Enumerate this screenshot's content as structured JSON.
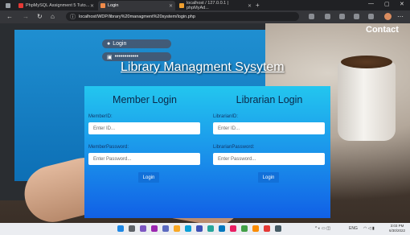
{
  "browser": {
    "tabs": [
      {
        "label": "PhpMySQL Assignment 5 Tuto...",
        "active": false
      },
      {
        "label": "Login",
        "active": true
      },
      {
        "label": "localhost / 127.0.0.1 | phpMyAd...",
        "active": false
      }
    ],
    "url": "localhost/WDP/library%20managment%20system/login.php"
  },
  "page": {
    "login_pill": "Login",
    "password_pill": "••••••••••••",
    "contact": "Contact",
    "title": "Library Managment Sysytem",
    "member": {
      "heading": "Member Login",
      "id_label": "MemberID:",
      "id_placeholder": "Enter ID...",
      "password_label": "MemberPassword:",
      "password_placeholder": "Enter Password...",
      "button": "Login"
    },
    "librarian": {
      "heading": "Librarian Login",
      "id_label": "LibrarianID:",
      "id_placeholder": "Enter ID...",
      "password_label": "LibrarianPassword:",
      "password_placeholder": "Enter Password...",
      "button": "Login"
    }
  },
  "taskbar": {
    "lang": "ENG",
    "time": "3:03 PM",
    "date": "6/30/2022"
  }
}
